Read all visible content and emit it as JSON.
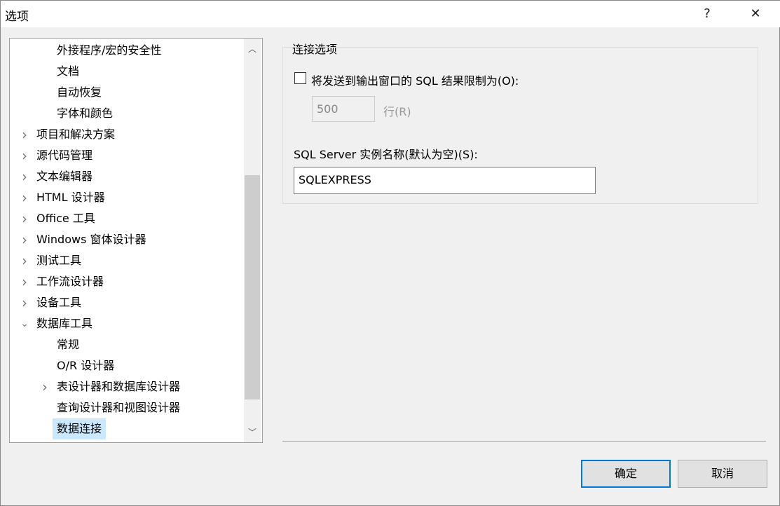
{
  "window": {
    "title": "选项",
    "help": "?",
    "close": "✕"
  },
  "tree": {
    "items": [
      {
        "label": "外接程序/宏的安全性",
        "level": 2,
        "chevron": ""
      },
      {
        "label": "文档",
        "level": 2,
        "chevron": ""
      },
      {
        "label": "自动恢复",
        "level": 2,
        "chevron": ""
      },
      {
        "label": "字体和颜色",
        "level": 2,
        "chevron": ""
      },
      {
        "label": "项目和解决方案",
        "level": 1,
        "chevron": "collapsed"
      },
      {
        "label": "源代码管理",
        "level": 1,
        "chevron": "collapsed"
      },
      {
        "label": "文本编辑器",
        "level": 1,
        "chevron": "collapsed"
      },
      {
        "label": "HTML 设计器",
        "level": 1,
        "chevron": "collapsed"
      },
      {
        "label": "Office 工具",
        "level": 1,
        "chevron": "collapsed"
      },
      {
        "label": "Windows 窗体设计器",
        "level": 1,
        "chevron": "collapsed"
      },
      {
        "label": "测试工具",
        "level": 1,
        "chevron": "collapsed"
      },
      {
        "label": "工作流设计器",
        "level": 1,
        "chevron": "collapsed"
      },
      {
        "label": "设备工具",
        "level": 1,
        "chevron": "collapsed"
      },
      {
        "label": "数据库工具",
        "level": 1,
        "chevron": "expanded"
      },
      {
        "label": "常规",
        "level": 2,
        "chevron": ""
      },
      {
        "label": "O/R 设计器",
        "level": 2,
        "chevron": ""
      },
      {
        "label": "表设计器和数据库设计器",
        "level": 2,
        "chevron": "collapsed"
      },
      {
        "label": "查询设计器和视图设计器",
        "level": 2,
        "chevron": ""
      },
      {
        "label": "数据连接",
        "level": 2,
        "chevron": "",
        "selected": true
      }
    ]
  },
  "panel": {
    "group_title": "连接选项",
    "limit_checkbox_label": "将发送到输出窗口的 SQL 结果限制为(O):",
    "limit_checked": false,
    "limit_value": "500",
    "rows_label": "行(R)",
    "instance_label": "SQL Server 实例名称(默认为空)(S):",
    "instance_value": "SQLEXPRESS"
  },
  "buttons": {
    "ok": "确定",
    "cancel": "取消"
  },
  "colors": {
    "selection": "#cce8ff",
    "default_button_border": "#0078d7"
  }
}
